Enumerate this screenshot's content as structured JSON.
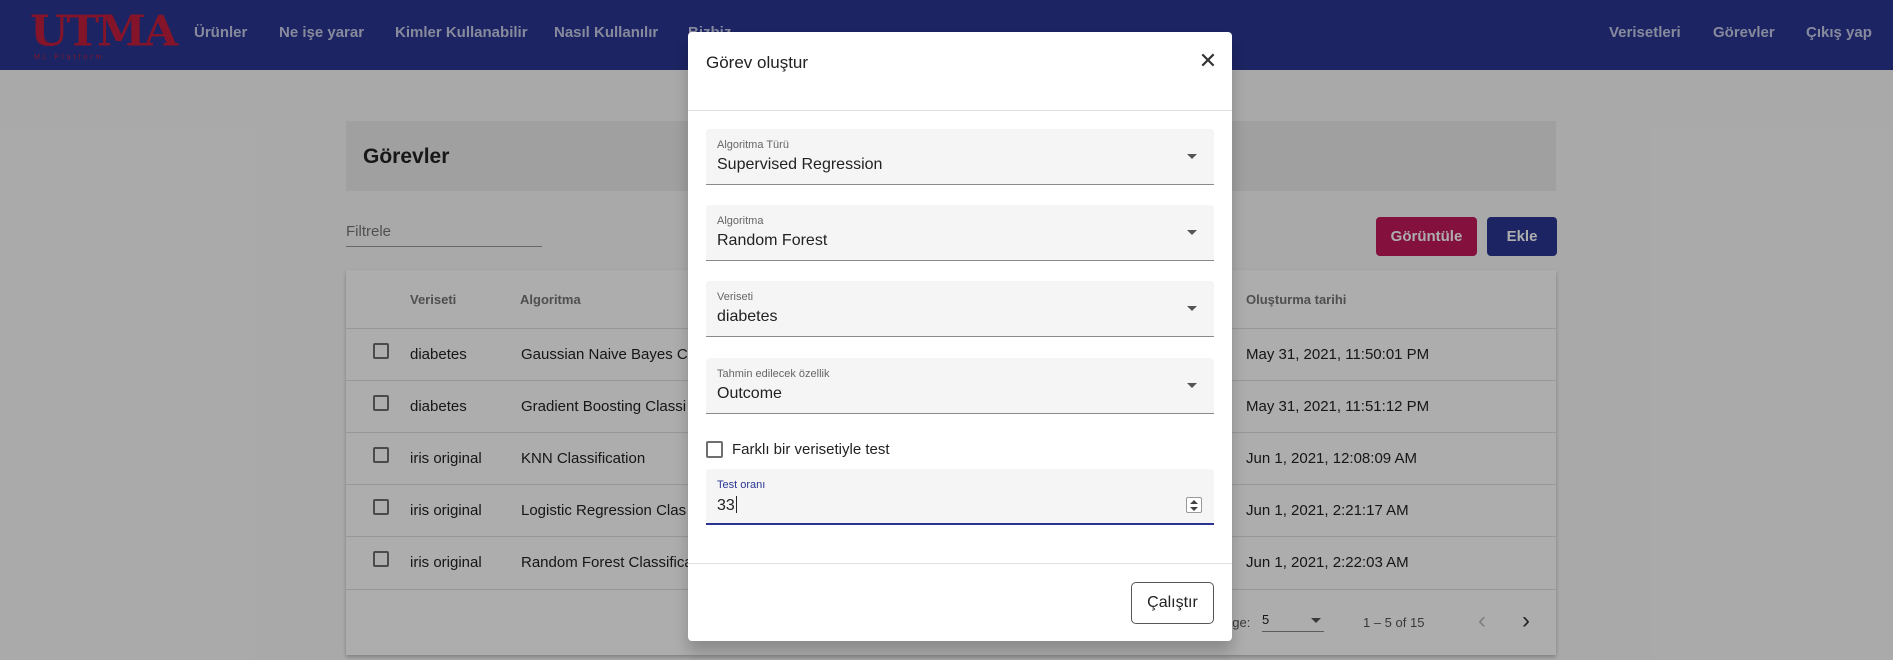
{
  "brand": {
    "logo_text": "UTMA",
    "logo_sub": "ML Platform"
  },
  "nav": {
    "left": [
      "Ürünler",
      "Ne işe yarar",
      "Kimler Kullanabilir",
      "Nasıl Kullanılır",
      "Bizbiz..."
    ],
    "right": [
      "Verisetleri",
      "Görevler",
      "Çıkış yap"
    ]
  },
  "page": {
    "title": "Görevler",
    "filter_placeholder": "Filtrele",
    "view_button": "Görüntüle",
    "add_button": "Ekle"
  },
  "table": {
    "headers": {
      "dataset": "Veriseti",
      "algorithm": "Algoritma",
      "created": "Oluşturma tarihi"
    },
    "rows": [
      {
        "dataset": "diabetes",
        "algorithm": "Gaussian Naive Bayes Cl",
        "created": "May 31, 2021, 11:50:01 PM"
      },
      {
        "dataset": "diabetes",
        "algorithm": "Gradient Boosting Classi",
        "created": "May 31, 2021, 11:51:12 PM"
      },
      {
        "dataset": "iris original",
        "algorithm": "KNN Classification",
        "created": "Jun 1, 2021, 12:08:09 AM"
      },
      {
        "dataset": "iris original",
        "algorithm": "Logistic Regression Clas",
        "created": "Jun 1, 2021, 2:21:17 AM"
      },
      {
        "dataset": "iris original",
        "algorithm": "Random Forest Classifica",
        "created": "Jun 1, 2021, 2:22:03 AM"
      }
    ],
    "paginator": {
      "label": "age:",
      "page_size": "5",
      "range": "1 – 5 of 15"
    }
  },
  "dialog": {
    "title": "Görev oluştur",
    "fields": {
      "algorithm_type": {
        "label": "Algoritma Türü",
        "value": "Supervised Regression"
      },
      "algorithm": {
        "label": "Algoritma",
        "value": "Random Forest"
      },
      "dataset": {
        "label": "Veriseti",
        "value": "diabetes"
      },
      "target": {
        "label": "Tahmin edilecek özellik",
        "value": "Outcome"
      },
      "test_ratio": {
        "label": "Test oranı",
        "value": "33"
      }
    },
    "checkbox_label": "Farklı bir verisetiyle test",
    "checkbox_checked": false,
    "run_button": "Çalıştır"
  },
  "colors": {
    "primary": "#2a3592",
    "accent": "#c2185b",
    "logo": "#c21e3d"
  }
}
